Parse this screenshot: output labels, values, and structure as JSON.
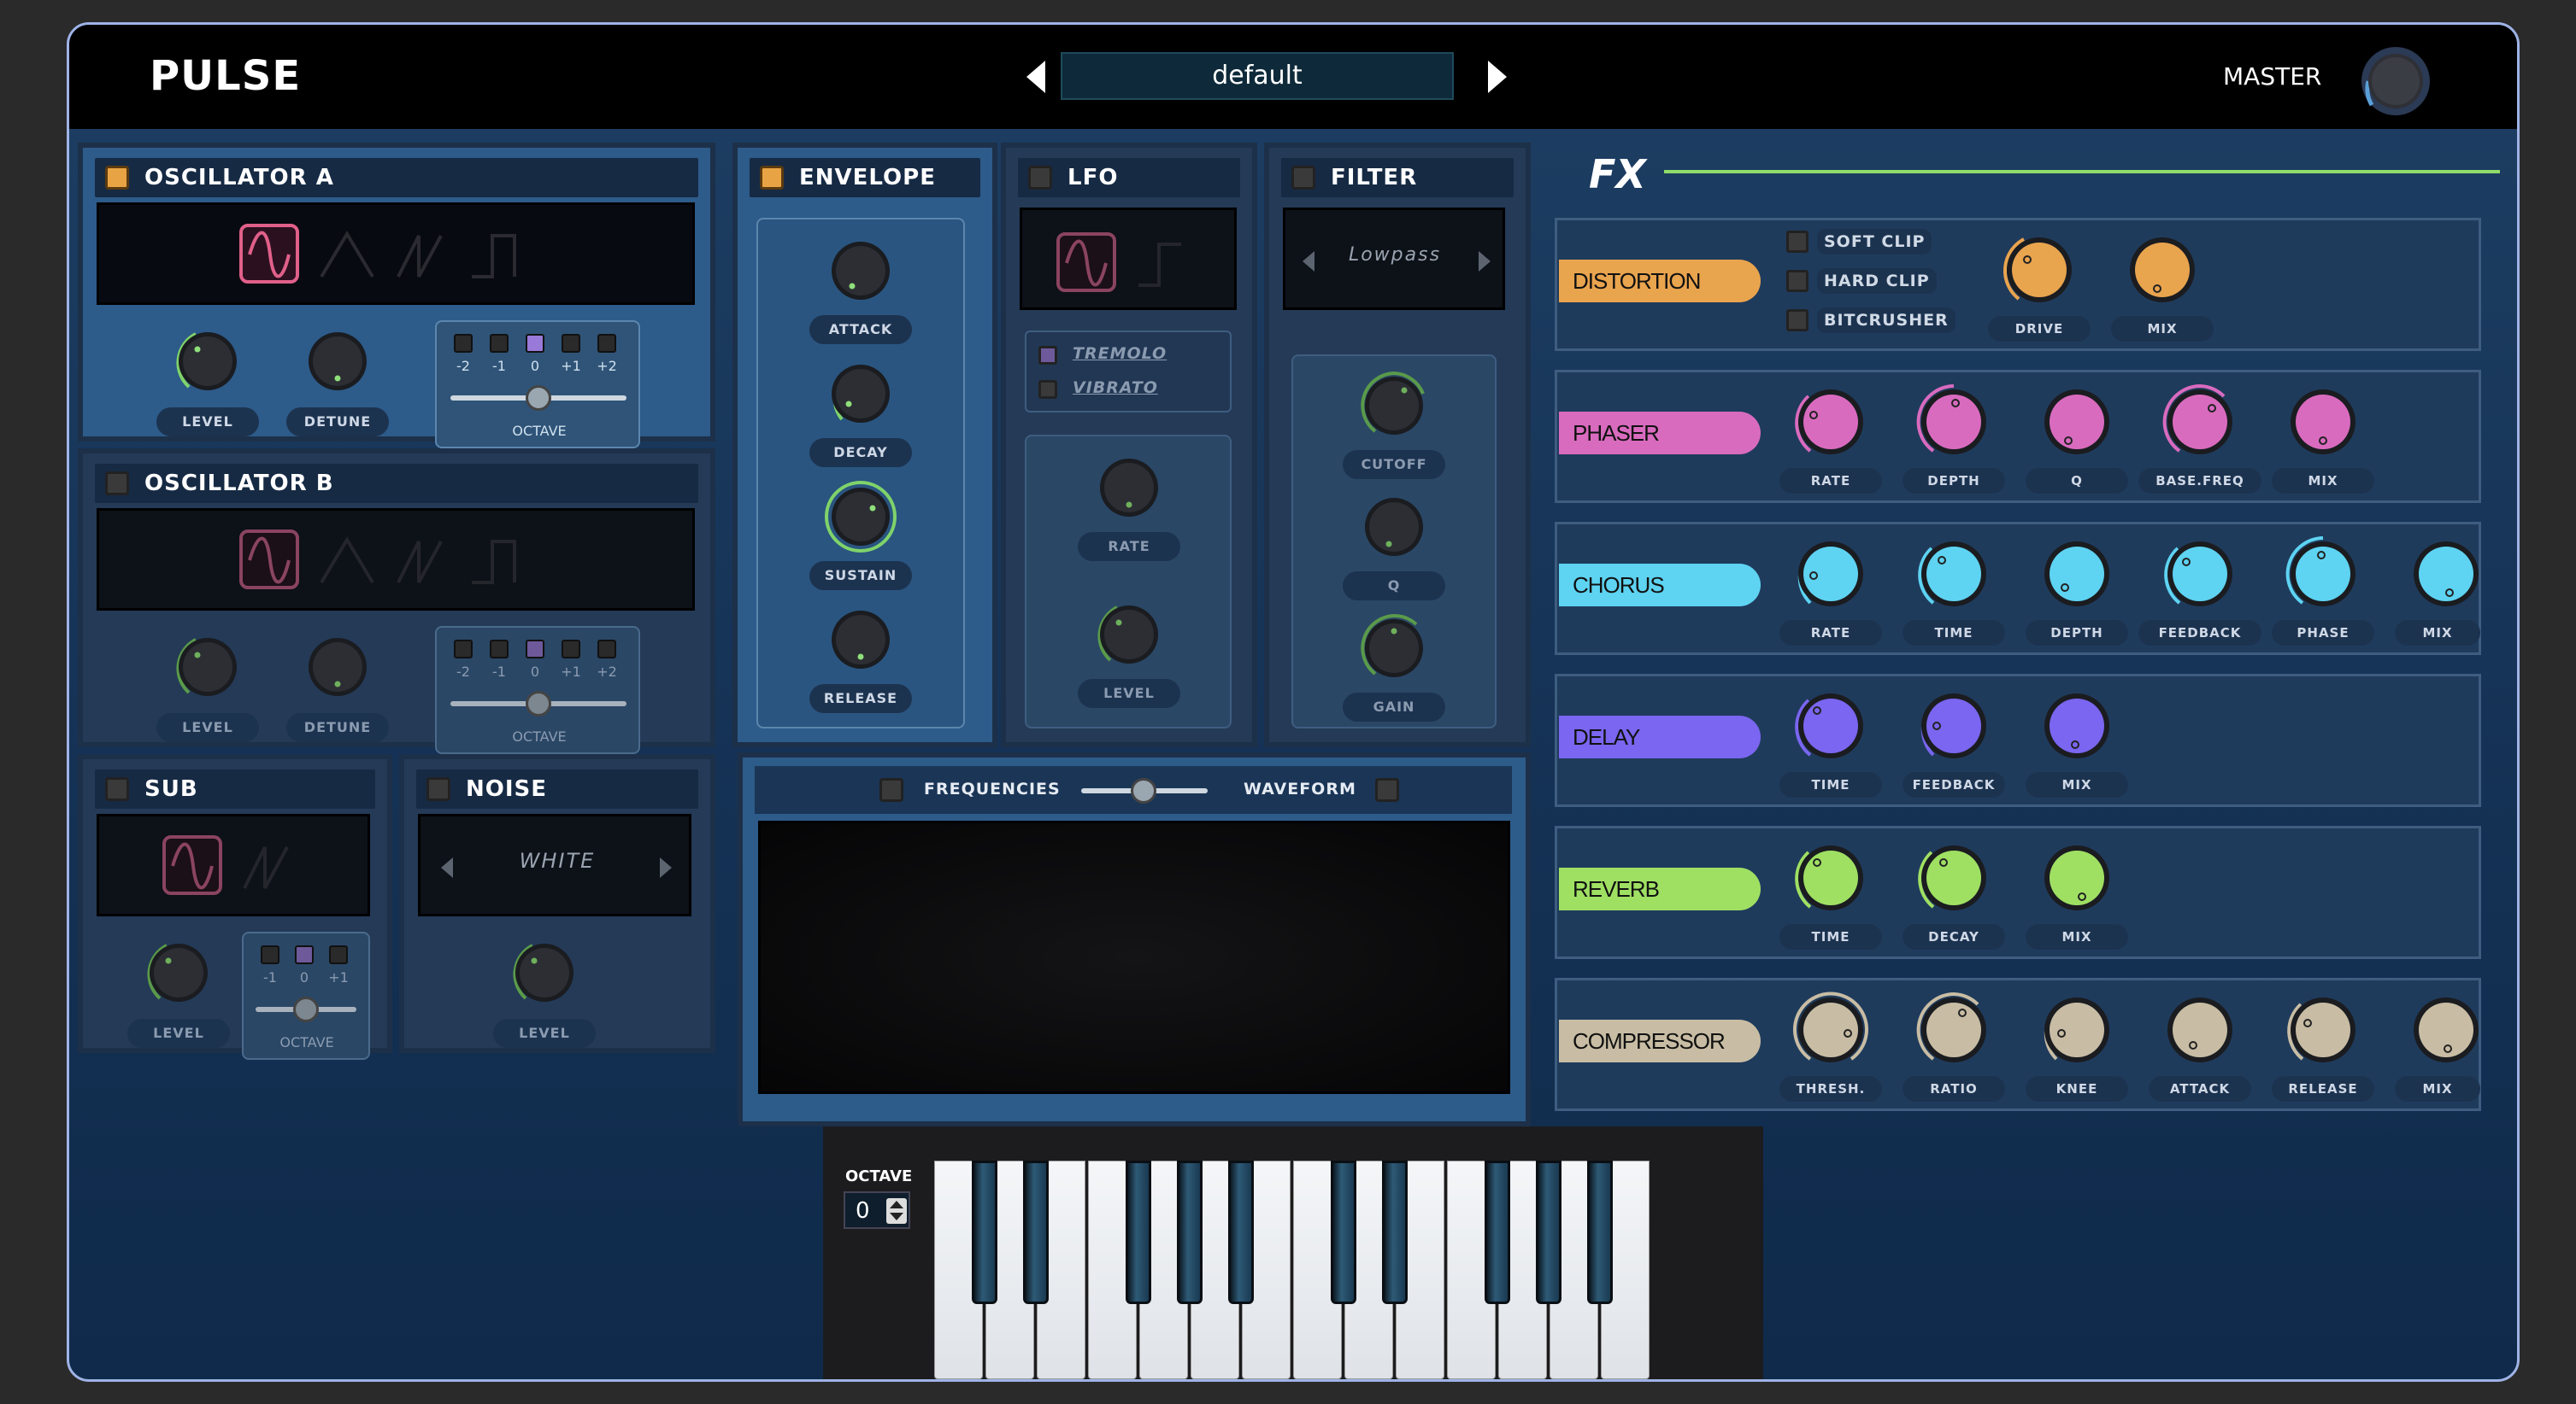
{
  "app": {
    "title": "PULSE"
  },
  "preset": {
    "name": "default"
  },
  "master": {
    "label": "MASTER"
  },
  "oscA": {
    "title": "OSCILLATOR A",
    "enabled": true,
    "knobs": [
      "LEVEL",
      "DETUNE"
    ],
    "octave_label": "OCTAVE",
    "octave_values": [
      "-2",
      "-1",
      "0",
      "+1",
      "+2"
    ],
    "octave_selected": "0"
  },
  "oscB": {
    "title": "OSCILLATOR B",
    "enabled": false,
    "knobs": [
      "LEVEL",
      "DETUNE"
    ],
    "octave_label": "OCTAVE",
    "octave_values": [
      "-2",
      "-1",
      "0",
      "+1",
      "+2"
    ],
    "octave_selected": "0"
  },
  "envelope": {
    "title": "ENVELOPE",
    "enabled": true,
    "knobs": [
      "ATTACK",
      "DECAY",
      "SUSTAIN",
      "RELEASE"
    ]
  },
  "lfo": {
    "title": "LFO",
    "enabled": false,
    "targets": [
      "TREMOLO",
      "VIBRATO"
    ],
    "knobs": [
      "RATE",
      "LEVEL"
    ]
  },
  "filter": {
    "title": "FILTER",
    "enabled": false,
    "type": "Lowpass",
    "knobs": [
      "CUTOFF",
      "Q",
      "GAIN"
    ]
  },
  "sub": {
    "title": "SUB",
    "enabled": false,
    "knobs": [
      "LEVEL"
    ],
    "octave_label": "OCTAVE",
    "octave_values": [
      "-1",
      "0",
      "+1"
    ],
    "octave_selected": "0"
  },
  "noise": {
    "title": "NOISE",
    "enabled": false,
    "type": "WHITE",
    "knobs": [
      "LEVEL"
    ]
  },
  "visualizer": {
    "left_label": "FREQUENCIES",
    "right_label": "WAVEFORM"
  },
  "fx": {
    "title": "FX",
    "distortion": {
      "name": "DISTORTION",
      "color": "#e9a44e",
      "options": [
        "SOFT CLIP",
        "HARD CLIP",
        "BITCRUSHER"
      ],
      "knobs": [
        "DRIVE",
        "MIX"
      ]
    },
    "phaser": {
      "name": "PHASER",
      "color": "#d96bbf",
      "knobs": [
        "RATE",
        "DEPTH",
        "Q",
        "BASE.FREQ",
        "MIX"
      ]
    },
    "chorus": {
      "name": "CHORUS",
      "color": "#5ed3f2",
      "knobs": [
        "RATE",
        "TIME",
        "DEPTH",
        "FEEDBACK",
        "PHASE",
        "MIX"
      ]
    },
    "delay": {
      "name": "DELAY",
      "color": "#7a66f0",
      "knobs": [
        "TIME",
        "FEEDBACK",
        "MIX"
      ]
    },
    "reverb": {
      "name": "REVERB",
      "color": "#9fe063",
      "knobs": [
        "TIME",
        "DECAY",
        "MIX"
      ]
    },
    "compressor": {
      "name": "COMPRESSOR",
      "color": "#c8bda4",
      "knobs": [
        "THRESH.",
        "RATIO",
        "KNEE",
        "ATTACK",
        "RELEASE",
        "MIX"
      ]
    }
  },
  "keyboard": {
    "octave_label": "OCTAVE",
    "octave_value": "0"
  }
}
